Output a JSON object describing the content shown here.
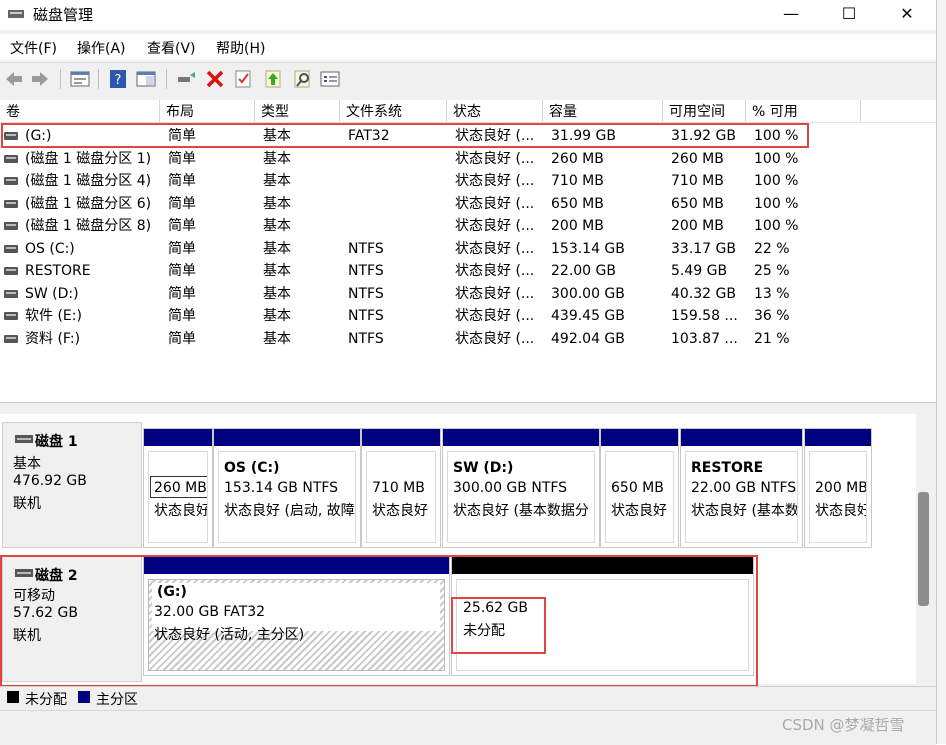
{
  "window": {
    "title": "磁盘管理",
    "minimize": "—",
    "maximize": "☐",
    "close": "✕"
  },
  "menu": [
    "文件(F)",
    "操作(A)",
    "查看(V)",
    "帮助(H)"
  ],
  "toolbar": [
    "back-icon",
    "forward-icon",
    "properties-icon",
    "help-icon",
    "show-hide-icon",
    "connect-icon",
    "delete-icon",
    "check-icon",
    "up-icon",
    "find-icon",
    "list-view-icon"
  ],
  "columns": [
    "卷",
    "布局",
    "类型",
    "文件系统",
    "状态",
    "容量",
    "可用空间",
    "% 可用"
  ],
  "volumes": [
    {
      "name": " (G:)",
      "layout": "简单",
      "type": "基本",
      "fs": "FAT32",
      "status": "状态良好 (...",
      "capacity": "31.99 GB",
      "free": "31.92 GB",
      "pct": "100 %"
    },
    {
      "name": "(磁盘 1 磁盘分区 1)",
      "layout": "简单",
      "type": "基本",
      "fs": "",
      "status": "状态良好 (...",
      "capacity": "260 MB",
      "free": "260 MB",
      "pct": "100 %"
    },
    {
      "name": "(磁盘 1 磁盘分区 4)",
      "layout": "简单",
      "type": "基本",
      "fs": "",
      "status": "状态良好 (...",
      "capacity": "710 MB",
      "free": "710 MB",
      "pct": "100 %"
    },
    {
      "name": "(磁盘 1 磁盘分区 6)",
      "layout": "简单",
      "type": "基本",
      "fs": "",
      "status": "状态良好 (...",
      "capacity": "650 MB",
      "free": "650 MB",
      "pct": "100 %"
    },
    {
      "name": "(磁盘 1 磁盘分区 8)",
      "layout": "简单",
      "type": "基本",
      "fs": "",
      "status": "状态良好 (...",
      "capacity": "200 MB",
      "free": "200 MB",
      "pct": "100 %"
    },
    {
      "name": "OS (C:)",
      "layout": "简单",
      "type": "基本",
      "fs": "NTFS",
      "status": "状态良好 (...",
      "capacity": "153.14 GB",
      "free": "33.17 GB",
      "pct": "22 %"
    },
    {
      "name": "RESTORE",
      "layout": "简单",
      "type": "基本",
      "fs": "NTFS",
      "status": "状态良好 (...",
      "capacity": "22.00 GB",
      "free": "5.49 GB",
      "pct": "25 %"
    },
    {
      "name": "SW (D:)",
      "layout": "简单",
      "type": "基本",
      "fs": "NTFS",
      "status": "状态良好 (...",
      "capacity": "300.00 GB",
      "free": "40.32 GB",
      "pct": "13 %"
    },
    {
      "name": "软件 (E:)",
      "layout": "简单",
      "type": "基本",
      "fs": "NTFS",
      "status": "状态良好 (...",
      "capacity": "439.45 GB",
      "free": "159.58 ...",
      "pct": "36 %"
    },
    {
      "name": "资料 (F:)",
      "layout": "简单",
      "type": "基本",
      "fs": "NTFS",
      "status": "状态良好 (...",
      "capacity": "492.04 GB",
      "free": "103.87 ...",
      "pct": "21 %"
    }
  ],
  "disk1": {
    "name": "磁盘 1",
    "kind": "基本",
    "size": "476.92 GB",
    "state": "联机",
    "partitions": [
      {
        "l1": "",
        "l2": "260 MB",
        "l3": "状态良好"
      },
      {
        "l1": "OS  (C:)",
        "l2": "153.14 GB NTFS",
        "l3": "状态良好 (启动, 故障"
      },
      {
        "l1": "",
        "l2": "710 MB",
        "l3": "状态良好"
      },
      {
        "l1": "SW  (D:)",
        "l2": "300.00 GB NTFS",
        "l3": "状态良好 (基本数据分"
      },
      {
        "l1": "",
        "l2": "650 MB",
        "l3": "状态良好"
      },
      {
        "l1": "RESTORE",
        "l2": "22.00 GB NTFS",
        "l3": "状态良好 (基本数"
      },
      {
        "l1": "",
        "l2": "200 MB",
        "l3": "状态良好"
      }
    ]
  },
  "disk2": {
    "name": "磁盘 2",
    "kind": "可移动",
    "size": "57.62 GB",
    "state": "联机",
    "partitions": [
      {
        "l1": " (G:)",
        "l2": "32.00 GB FAT32",
        "l3": "状态良好 (活动, 主分区)"
      },
      {
        "l1": "25.62 GB",
        "l2": "未分配",
        "l3": ""
      }
    ]
  },
  "legend": {
    "unallocated": "未分配",
    "primary": "主分区"
  },
  "watermark": "CSDN @梦凝哲雪",
  "colors": {
    "primary": "#000080",
    "unallocated": "#000000",
    "highlight": "#e04545"
  }
}
